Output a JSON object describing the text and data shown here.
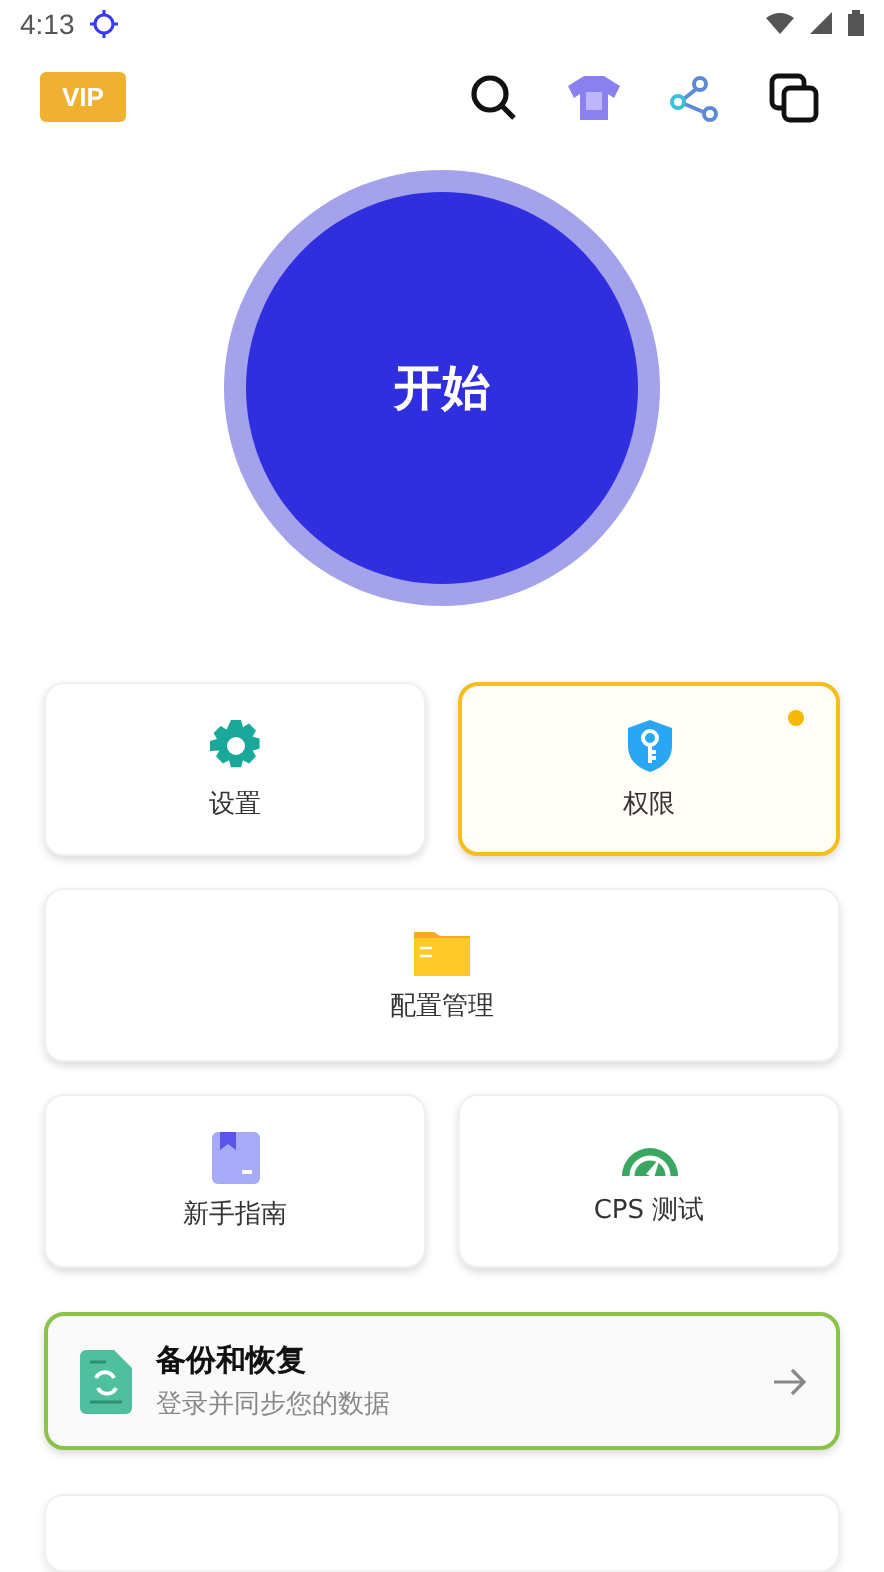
{
  "status_bar": {
    "time": "4:13"
  },
  "header": {
    "vip_badge": "VIP"
  },
  "start_button": {
    "label": "开始"
  },
  "cards": [
    {
      "label": "设置",
      "highlighted": false,
      "wide": false,
      "notification_dot": false
    },
    {
      "label": "权限",
      "highlighted": true,
      "wide": false,
      "notification_dot": true
    },
    {
      "label": "配置管理",
      "highlighted": false,
      "wide": true,
      "notification_dot": false
    },
    {
      "label": "新手指南",
      "highlighted": false,
      "wide": false,
      "notification_dot": false
    },
    {
      "label": "CPS 测试",
      "highlighted": false,
      "wide": false,
      "notification_dot": false
    }
  ],
  "backup_card": {
    "title": "备份和恢复",
    "subtitle": "登录并同步您的数据"
  }
}
